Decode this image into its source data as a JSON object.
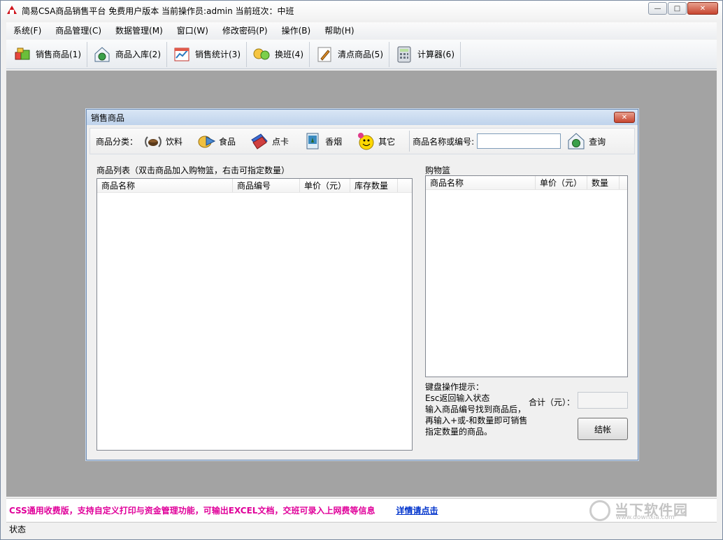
{
  "window": {
    "title": "简易CSA商品销售平台 免费用户版本 当前操作员:admin 当前班次：中班"
  },
  "menu": [
    "系统(F)",
    "商品管理(C)",
    "数据管理(M)",
    "窗口(W)",
    "修改密码(P)",
    "操作(B)",
    "帮助(H)"
  ],
  "toolbar": [
    {
      "label": "销售商品(1)",
      "icon": "cash-register-icon"
    },
    {
      "label": "商品入库(2)",
      "icon": "warehouse-icon"
    },
    {
      "label": "销售统计(3)",
      "icon": "chart-icon"
    },
    {
      "label": "换班(4)",
      "icon": "shift-icon"
    },
    {
      "label": "清点商品(5)",
      "icon": "pencil-icon"
    },
    {
      "label": "计算器(6)",
      "icon": "calculator-icon"
    }
  ],
  "dialog": {
    "title": "销售商品",
    "category_label": "商品分类：",
    "categories": [
      {
        "label": "饮料",
        "icon": "coffee-cup-icon"
      },
      {
        "label": "食品",
        "icon": "food-icon"
      },
      {
        "label": "点卡",
        "icon": "card-icon"
      },
      {
        "label": "香烟",
        "icon": "cigarette-icon"
      },
      {
        "label": "其它",
        "icon": "smiley-icon"
      }
    ],
    "search_label": "商品名称或编号:",
    "search_value": "",
    "query_label": "查询",
    "product_list": {
      "label": "商品列表（双击商品加入购物篮，右击可指定数量）",
      "columns": [
        "商品名称",
        "商品编号",
        "单价（元）",
        "库存数量"
      ]
    },
    "basket": {
      "label": "购物篮",
      "columns": [
        "商品名称",
        "单价（元）",
        "数量"
      ]
    },
    "hints": [
      "键盘操作提示：",
      "Esc返回输入状态",
      "输入商品编号找到商品后，",
      "再输入+或-和数量即可销售",
      "指定数量的商品。"
    ],
    "total_label": "合计（元）：",
    "total_value": "",
    "checkout_label": "结帐"
  },
  "adbar": {
    "text": "CSS通用收费版，支持自定义打印与资金管理功能，可输出EXCEL文档，交班可录入上网费等信息",
    "link": "详情请点击",
    "watermark": "当下软件园",
    "watermark_url": "www.downxia.com"
  },
  "status": "状态"
}
